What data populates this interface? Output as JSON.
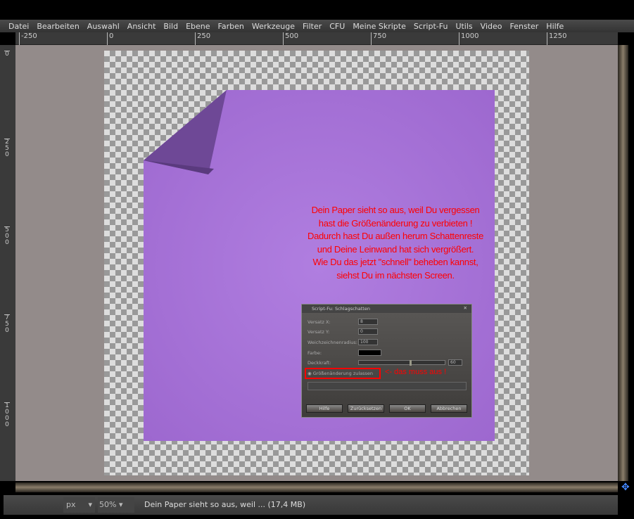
{
  "menu": [
    "Datei",
    "Bearbeiten",
    "Auswahl",
    "Ansicht",
    "Bild",
    "Ebene",
    "Farben",
    "Werkzeuge",
    "Filter",
    "CFU",
    "Meine Skripte",
    "Script-Fu",
    "Utils",
    "Video",
    "Fenster",
    "Hilfe"
  ],
  "hruler": [
    "-250",
    "0",
    "250",
    "500",
    "750",
    "1000",
    "1250"
  ],
  "vruler": [
    "0",
    "250",
    "500",
    "750",
    "1000"
  ],
  "paper_color": "#a874d8",
  "note": {
    "lines": [
      "Dein Paper sieht so aus, weil Du vergessen",
      "hast die Größenänderung zu verbieten !",
      "Dadurch hast Du außen herum Schattenreste",
      "und Deine Leinwand hat sich vergrößert.",
      "Wie Du das jetzt \"schnell\" beheben kannst,",
      "siehst Du im nächsten Screen."
    ],
    "color": "#ff0000"
  },
  "dialog": {
    "title": "Script-Fu: Schlagschatten",
    "versatz_x_label": "Versatz X:",
    "versatz_x": "8",
    "versatz_y_label": "Versatz Y:",
    "versatz_y": "0",
    "radius_label": "Weichzeichnenradius:",
    "radius": "100",
    "farbe_label": "Farbe:",
    "deckkraft_label": "Deckkraft:",
    "deckkraft": "60",
    "deckkraft_level": 60,
    "resize_label": "Größenänderung zulassen",
    "arrow_note": "<- das muss aus !",
    "buttons": [
      "Hilfe",
      "Zurücksetzen",
      "OK",
      "Abbrechen"
    ]
  },
  "status": {
    "unit": "px",
    "zoom": "50",
    "zoom_unit": "%",
    "message": "Dein Paper sieht so aus, weil ... (17,4 MB)"
  }
}
